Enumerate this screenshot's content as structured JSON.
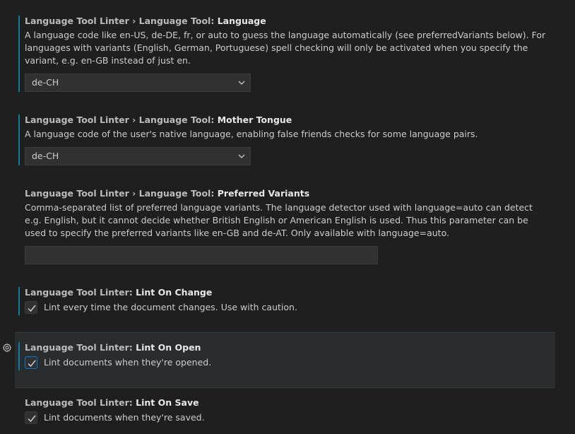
{
  "settings": [
    {
      "category": "Language Tool Linter › Language Tool: ",
      "key": "Language",
      "description": "A language code like en-US, de-DE, fr, or auto to guess the language automatically (see preferredVariants below). For languages with variants (English, German, Portuguese) spell checking will only be activated when you specify the variant, e.g. en-GB instead of just en.",
      "value": "de-CH"
    },
    {
      "category": "Language Tool Linter › Language Tool: ",
      "key": "Mother Tongue",
      "description": "A language code of the user's native language, enabling false friends checks for some language pairs.",
      "value": "de-CH"
    },
    {
      "category": "Language Tool Linter › Language Tool: ",
      "key": "Preferred Variants",
      "description": "Comma-separated list of preferred language variants. The language detector used with language=auto can detect e.g. English, but it cannot decide whether British English or American English is used. Thus this parameter can be used to specify the preferred variants like en-GB and de-AT. Only available with language=auto.",
      "value": ""
    },
    {
      "category": "Language Tool Linter: ",
      "key": "Lint On Change",
      "label": "Lint every time the document changes. Use with caution.",
      "checked": true
    },
    {
      "category": "Language Tool Linter: ",
      "key": "Lint On Open",
      "label": "Lint documents when they're opened.",
      "checked": true
    },
    {
      "category": "Language Tool Linter: ",
      "key": "Lint On Save",
      "label": "Lint documents when they're saved.",
      "checked": true
    }
  ],
  "icons": {
    "dropdown": "chevron-down-icon",
    "check": "check-icon",
    "settings": "gear-icon"
  },
  "colors": {
    "background": "#1f1f1f",
    "modified_indicator": "#0c7d9d",
    "focus_border": "#0078d4"
  }
}
